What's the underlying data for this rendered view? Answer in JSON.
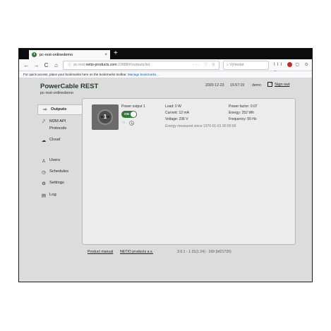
{
  "browser": {
    "tab_title": "pc-rest-onlinedemo",
    "tab_close": "×",
    "new_tab": "+",
    "nav": {
      "back": "←",
      "forward": "→",
      "reload": "C",
      "home": "⌂"
    },
    "url": {
      "lock": "ⓘ",
      "prefix": "pc-rest.",
      "host": "netio-products.com",
      "port_path": ":22888/#/outputs/list"
    },
    "url_tools": "··· ♡ ☆",
    "search_placeholder": "Vyhledat",
    "right_tools": "III ▢ ⊙ ≡",
    "bookmarks_text": "For quick access, place your bookmarks here on the bookmarks toolbar.",
    "bookmarks_link": "Manage bookmarks..."
  },
  "header": {
    "brand": "PowerCable REST",
    "device_name": "pc-rest-onlinedemo",
    "date": "2020-12-23",
    "time": "15:57:19",
    "user": "demo",
    "sign_out": "Sign out"
  },
  "sidebar": {
    "items": [
      {
        "label": "Outputs",
        "icon": "⇨"
      },
      {
        "label": "M2M API",
        "sub": "Protocols",
        "icon": "⤤"
      },
      {
        "label": "Cloud",
        "icon": "☁"
      },
      {
        "label": "Users",
        "icon": "♙"
      },
      {
        "label": "Schedules",
        "icon": "◷"
      },
      {
        "label": "Settings",
        "icon": "⚙"
      },
      {
        "label": "Log",
        "icon": "▤"
      }
    ]
  },
  "output": {
    "number": "1",
    "name": "Power output 1",
    "state_label": "ON",
    "state_on": true,
    "sun_icon": "☼",
    "metrics": {
      "load": "Load: 0 W",
      "current": "Current: 12 mA",
      "voltage": "Voltage: 236 V",
      "power_factor": "Power factor: 0.07",
      "energy": "Energy: 252 Wh",
      "frequency": "Frequency: 50 Hz",
      "energy_since": "Energy measured since 1970-01-01 00:00:00"
    }
  },
  "footer": {
    "manual": "Product manual",
    "company": "NETIO products a.s.",
    "version": "3.0.1 - 1.31(1.24) - 169 (bf21720)"
  },
  "colors": {
    "accent": "#2e7d32",
    "brand": "#1f3d2b",
    "page_bg": "#dcdcdc",
    "panel_bg": "#ececec"
  }
}
